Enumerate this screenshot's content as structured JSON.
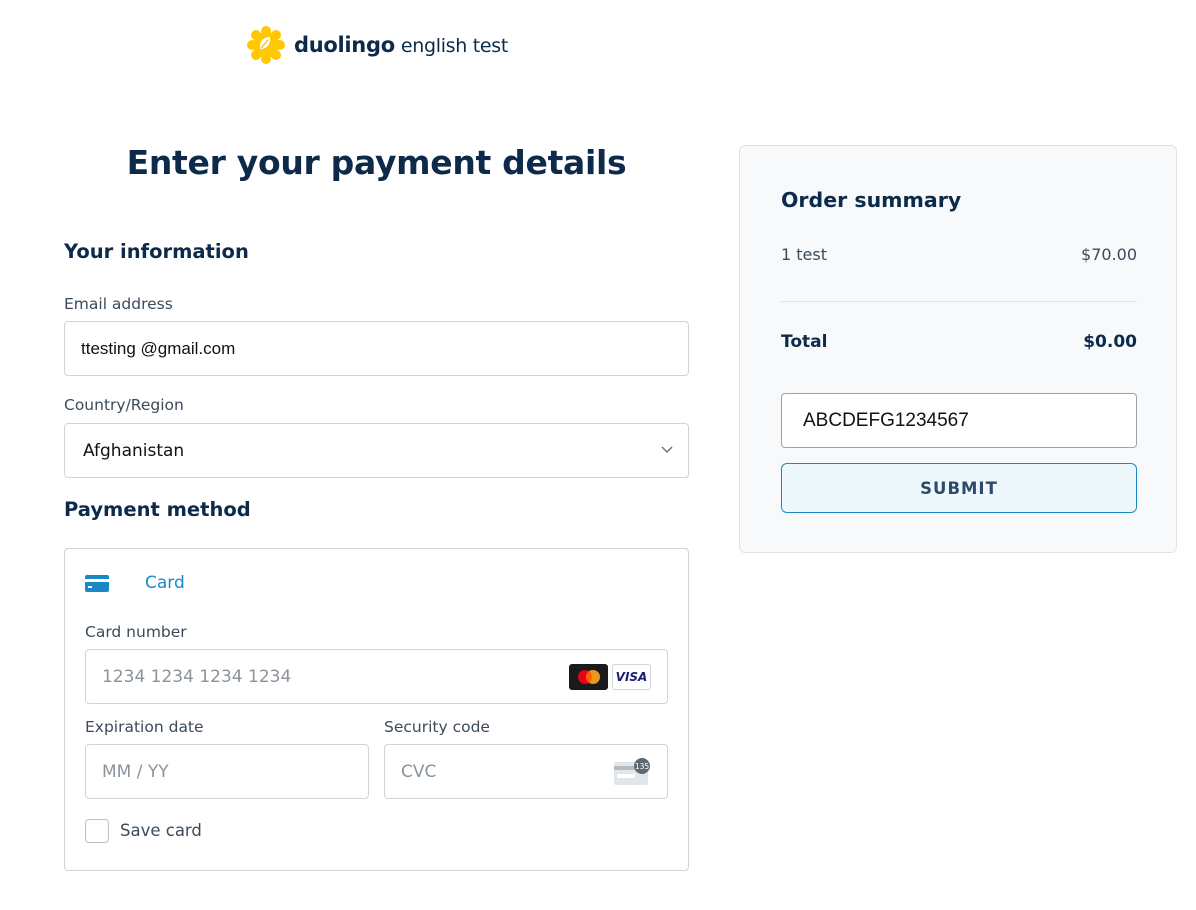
{
  "brand": {
    "name": "duolingo",
    "product": "english test",
    "icon": "duolingo-flower-logo",
    "color": "#ffc800"
  },
  "page": {
    "title": "Enter your payment details"
  },
  "your_information": {
    "heading": "Your information",
    "email": {
      "label": "Email address",
      "value": "ttesting @gmail.com"
    },
    "country": {
      "label": "Country/Region",
      "value": "Afghanistan"
    }
  },
  "payment_method": {
    "heading": "Payment method",
    "method_label": "Card",
    "card_number": {
      "label": "Card number",
      "placeholder": "1234 1234 1234 1234"
    },
    "card_brands": [
      "mastercard",
      "VISA"
    ],
    "expiration": {
      "label": "Expiration date",
      "placeholder": "MM / YY"
    },
    "security_code": {
      "label": "Security code",
      "placeholder": "CVC",
      "icon_digits": "135"
    },
    "save_card": {
      "label": "Save card",
      "checked": false
    }
  },
  "order_summary": {
    "title": "Order summary",
    "item": {
      "name": "1 test",
      "price": "$70.00"
    },
    "total": {
      "label": "Total",
      "value": "$0.00"
    },
    "promo_code": "ABCDEFG1234567",
    "submit_label": "SUBMIT"
  },
  "colors": {
    "heading": "#0d2a4a",
    "accent": "#1b87c9",
    "panel_bg": "#f7f9fa"
  }
}
